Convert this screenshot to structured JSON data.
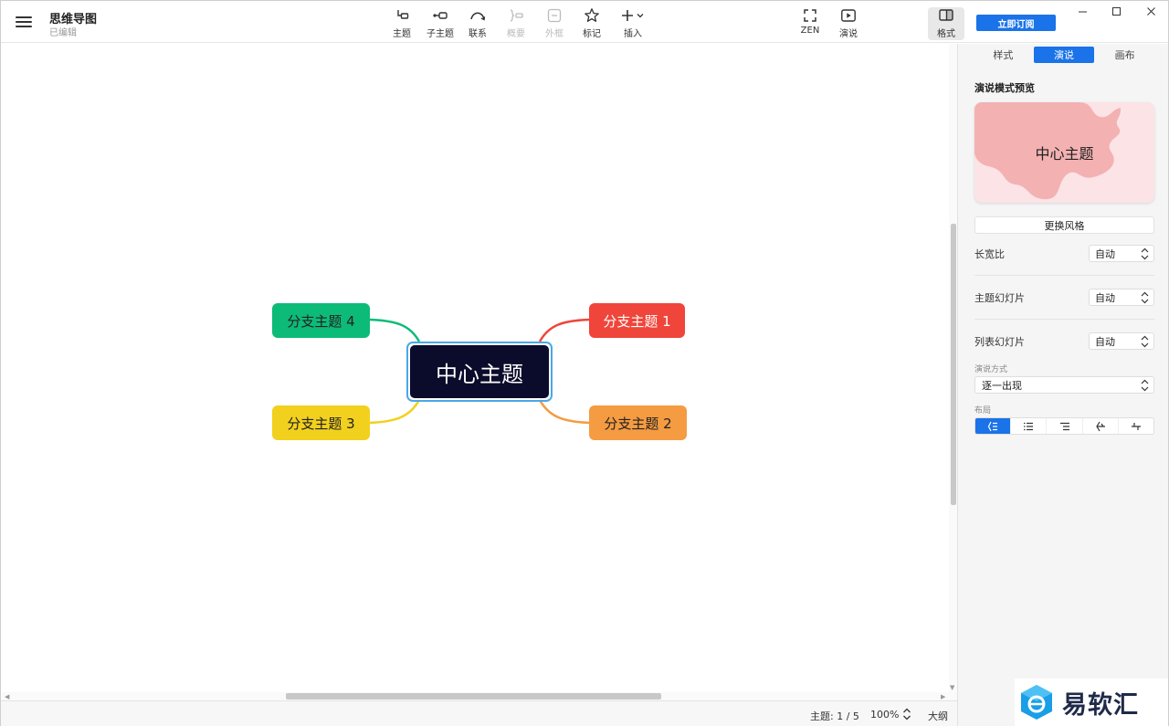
{
  "header": {
    "title": "思维导图",
    "status": "已编辑",
    "subscribe_label": "立即订阅"
  },
  "toolbar": {
    "topic": "主题",
    "subtopic": "子主题",
    "relation": "联系",
    "summary": "概要",
    "boundary": "外框",
    "marker": "标记",
    "insert": "插入",
    "zen": "ZEN",
    "pitch": "演说",
    "format": "格式"
  },
  "mindmap": {
    "central": "中心主题",
    "branches": [
      {
        "label": "分支主题 1",
        "color": "#f0453a"
      },
      {
        "label": "分支主题 2",
        "color": "#f59b42"
      },
      {
        "label": "分支主题 3",
        "color": "#f2d01e"
      },
      {
        "label": "分支主题 4",
        "color": "#0dbb78"
      }
    ],
    "central_color": "#0b0b2b",
    "selection_color": "#4aa8e8"
  },
  "statusbar": {
    "topic_count": "主题: 1 / 5",
    "zoom": "100%",
    "outline": "大纲"
  },
  "panel": {
    "tabs": [
      {
        "label": "样式",
        "active": false
      },
      {
        "label": "演说",
        "active": true
      },
      {
        "label": "画布",
        "active": false
      }
    ],
    "heading": "演说模式预览",
    "preview_text": "中心主题",
    "change_style": "更换风格",
    "aspect_ratio_label": "长宽比",
    "aspect_ratio_value": "自动",
    "topic_slides_label": "主题幻灯片",
    "topic_slides_value": "自动",
    "list_slides_label": "列表幻灯片",
    "list_slides_value": "自动",
    "pitch_mode_label": "演说方式",
    "pitch_mode_value": "逐一出现",
    "layout_label": "布局",
    "accent_color": "#1a73e8"
  },
  "watermark": {
    "text": "易软汇"
  }
}
